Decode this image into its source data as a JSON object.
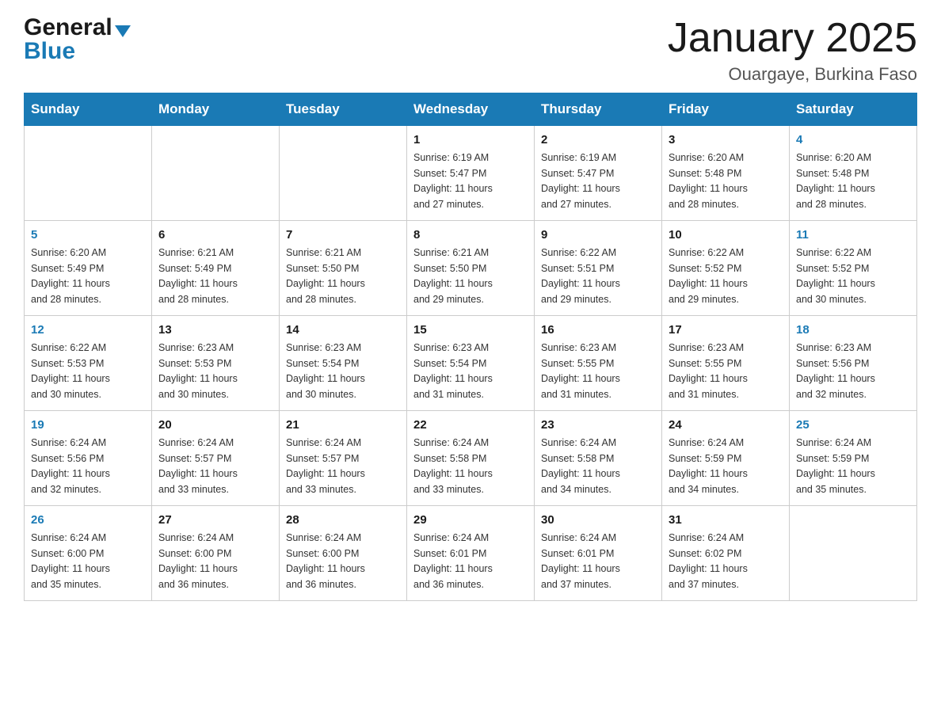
{
  "logo": {
    "general": "General",
    "blue": "Blue",
    "arrow": "▼"
  },
  "title": "January 2025",
  "subtitle": "Ouargaye, Burkina Faso",
  "days_of_week": [
    "Sunday",
    "Monday",
    "Tuesday",
    "Wednesday",
    "Thursday",
    "Friday",
    "Saturday"
  ],
  "weeks": [
    [
      {
        "day": "",
        "info": ""
      },
      {
        "day": "",
        "info": ""
      },
      {
        "day": "",
        "info": ""
      },
      {
        "day": "1",
        "info": "Sunrise: 6:19 AM\nSunset: 5:47 PM\nDaylight: 11 hours\nand 27 minutes."
      },
      {
        "day": "2",
        "info": "Sunrise: 6:19 AM\nSunset: 5:47 PM\nDaylight: 11 hours\nand 27 minutes."
      },
      {
        "day": "3",
        "info": "Sunrise: 6:20 AM\nSunset: 5:48 PM\nDaylight: 11 hours\nand 28 minutes."
      },
      {
        "day": "4",
        "info": "Sunrise: 6:20 AM\nSunset: 5:48 PM\nDaylight: 11 hours\nand 28 minutes."
      }
    ],
    [
      {
        "day": "5",
        "info": "Sunrise: 6:20 AM\nSunset: 5:49 PM\nDaylight: 11 hours\nand 28 minutes."
      },
      {
        "day": "6",
        "info": "Sunrise: 6:21 AM\nSunset: 5:49 PM\nDaylight: 11 hours\nand 28 minutes."
      },
      {
        "day": "7",
        "info": "Sunrise: 6:21 AM\nSunset: 5:50 PM\nDaylight: 11 hours\nand 28 minutes."
      },
      {
        "day": "8",
        "info": "Sunrise: 6:21 AM\nSunset: 5:50 PM\nDaylight: 11 hours\nand 29 minutes."
      },
      {
        "day": "9",
        "info": "Sunrise: 6:22 AM\nSunset: 5:51 PM\nDaylight: 11 hours\nand 29 minutes."
      },
      {
        "day": "10",
        "info": "Sunrise: 6:22 AM\nSunset: 5:52 PM\nDaylight: 11 hours\nand 29 minutes."
      },
      {
        "day": "11",
        "info": "Sunrise: 6:22 AM\nSunset: 5:52 PM\nDaylight: 11 hours\nand 30 minutes."
      }
    ],
    [
      {
        "day": "12",
        "info": "Sunrise: 6:22 AM\nSunset: 5:53 PM\nDaylight: 11 hours\nand 30 minutes."
      },
      {
        "day": "13",
        "info": "Sunrise: 6:23 AM\nSunset: 5:53 PM\nDaylight: 11 hours\nand 30 minutes."
      },
      {
        "day": "14",
        "info": "Sunrise: 6:23 AM\nSunset: 5:54 PM\nDaylight: 11 hours\nand 30 minutes."
      },
      {
        "day": "15",
        "info": "Sunrise: 6:23 AM\nSunset: 5:54 PM\nDaylight: 11 hours\nand 31 minutes."
      },
      {
        "day": "16",
        "info": "Sunrise: 6:23 AM\nSunset: 5:55 PM\nDaylight: 11 hours\nand 31 minutes."
      },
      {
        "day": "17",
        "info": "Sunrise: 6:23 AM\nSunset: 5:55 PM\nDaylight: 11 hours\nand 31 minutes."
      },
      {
        "day": "18",
        "info": "Sunrise: 6:23 AM\nSunset: 5:56 PM\nDaylight: 11 hours\nand 32 minutes."
      }
    ],
    [
      {
        "day": "19",
        "info": "Sunrise: 6:24 AM\nSunset: 5:56 PM\nDaylight: 11 hours\nand 32 minutes."
      },
      {
        "day": "20",
        "info": "Sunrise: 6:24 AM\nSunset: 5:57 PM\nDaylight: 11 hours\nand 33 minutes."
      },
      {
        "day": "21",
        "info": "Sunrise: 6:24 AM\nSunset: 5:57 PM\nDaylight: 11 hours\nand 33 minutes."
      },
      {
        "day": "22",
        "info": "Sunrise: 6:24 AM\nSunset: 5:58 PM\nDaylight: 11 hours\nand 33 minutes."
      },
      {
        "day": "23",
        "info": "Sunrise: 6:24 AM\nSunset: 5:58 PM\nDaylight: 11 hours\nand 34 minutes."
      },
      {
        "day": "24",
        "info": "Sunrise: 6:24 AM\nSunset: 5:59 PM\nDaylight: 11 hours\nand 34 minutes."
      },
      {
        "day": "25",
        "info": "Sunrise: 6:24 AM\nSunset: 5:59 PM\nDaylight: 11 hours\nand 35 minutes."
      }
    ],
    [
      {
        "day": "26",
        "info": "Sunrise: 6:24 AM\nSunset: 6:00 PM\nDaylight: 11 hours\nand 35 minutes."
      },
      {
        "day": "27",
        "info": "Sunrise: 6:24 AM\nSunset: 6:00 PM\nDaylight: 11 hours\nand 36 minutes."
      },
      {
        "day": "28",
        "info": "Sunrise: 6:24 AM\nSunset: 6:00 PM\nDaylight: 11 hours\nand 36 minutes."
      },
      {
        "day": "29",
        "info": "Sunrise: 6:24 AM\nSunset: 6:01 PM\nDaylight: 11 hours\nand 36 minutes."
      },
      {
        "day": "30",
        "info": "Sunrise: 6:24 AM\nSunset: 6:01 PM\nDaylight: 11 hours\nand 37 minutes."
      },
      {
        "day": "31",
        "info": "Sunrise: 6:24 AM\nSunset: 6:02 PM\nDaylight: 11 hours\nand 37 minutes."
      },
      {
        "day": "",
        "info": ""
      }
    ]
  ]
}
